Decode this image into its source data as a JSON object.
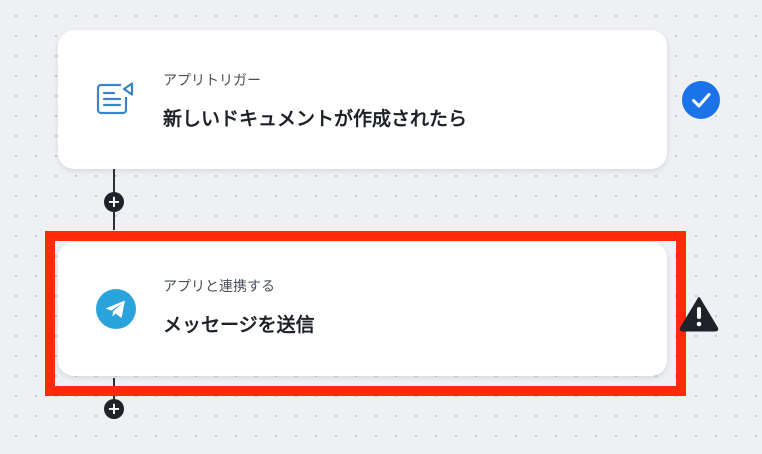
{
  "flow": {
    "steps": [
      {
        "subtitle": "アプリトリガー",
        "title": "新しいドキュメントが作成されたら",
        "icon": "document-trigger-icon",
        "status": "check-icon"
      },
      {
        "subtitle": "アプリと連携する",
        "title": "メッセージを送信",
        "icon": "telegram-icon",
        "status": "warning-icon"
      }
    ],
    "add_glyph": "+"
  },
  "colors": {
    "accent": "#1a73e8",
    "highlight": "#ff2a0a",
    "icon_blue": "#3a84c6",
    "telegram": "#2aa3dd",
    "warning": "#1f2329"
  }
}
